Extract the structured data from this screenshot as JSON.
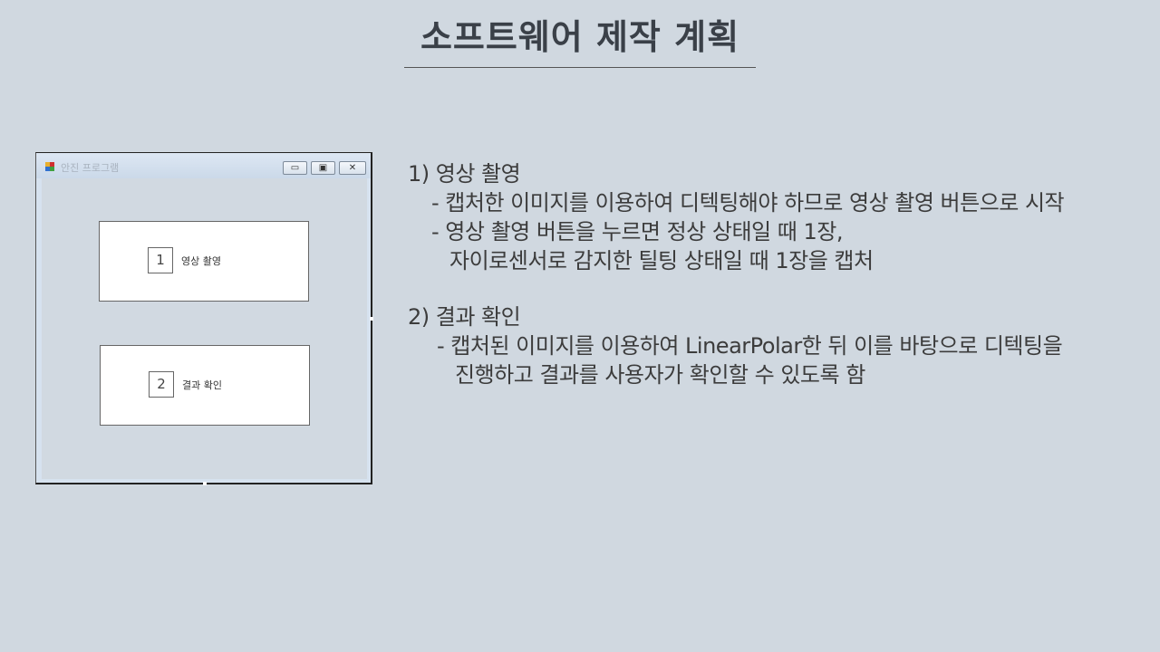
{
  "slide": {
    "title": "소프트웨어 제작 계획"
  },
  "window": {
    "title": "안진 프로그램",
    "icon": "app-icon",
    "controls": {
      "minimize": "▭",
      "maximize": "▣",
      "close": "✕"
    },
    "buttons": [
      {
        "number": "1",
        "label": "영상 촬영"
      },
      {
        "number": "2",
        "label": "결과 확인"
      }
    ]
  },
  "description": {
    "sections": [
      {
        "heading": "1) 영상 촬영",
        "lines": [
          "- 캡처한 이미지를 이용하여 디텍팅해야 하므로 영상 촬영 버튼으로 시작",
          "- 영상 촬영 버튼을 누르면 정상 상태일 때 1장,",
          "자이로센서로 감지한 틸팅 상태일 때 1장을 캡처"
        ]
      },
      {
        "heading": "2) 결과 확인",
        "lines": [
          "- 캡처된 이미지를 이용하여 LinearPolar한 뒤 이를 바탕으로 디텍팅을",
          "진행하고 결과를 사용자가 확인할 수 있도록 함"
        ]
      }
    ]
  }
}
